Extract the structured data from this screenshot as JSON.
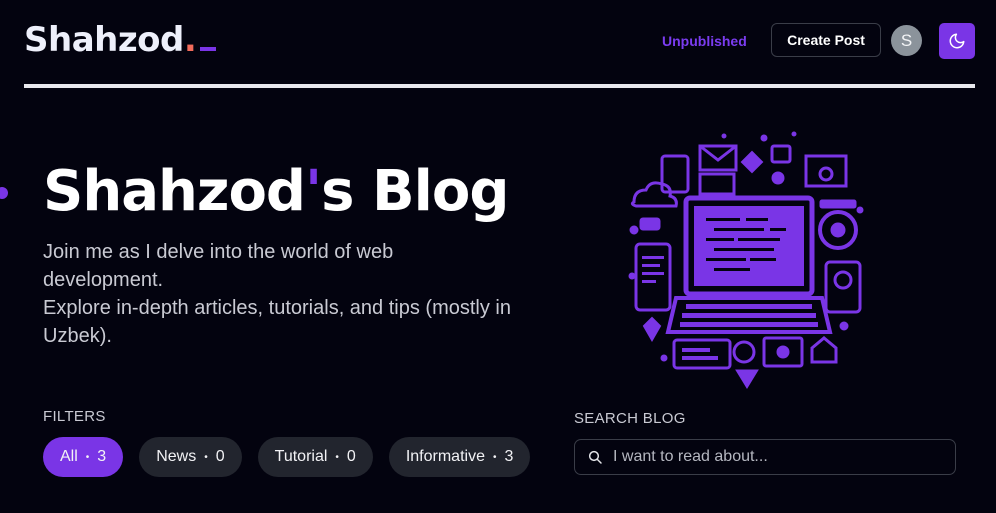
{
  "header": {
    "logo_text": "Shahzod",
    "logo_dot": ".",
    "nav_unpublished": "Unpublished",
    "create_post_label": "Create Post",
    "avatar_initial": "S",
    "theme_icon": "moon-icon"
  },
  "hero": {
    "title_part1": "Shahzod",
    "title_apostrophe": "'",
    "title_part2": "s Blog",
    "description_line1": "Join me as I delve into the world of web development.",
    "description_line2": "Explore in-depth articles, tutorials, and tips (mostly in Uzbek)."
  },
  "filters": {
    "label": "FILTERS",
    "separator": "•",
    "items": [
      {
        "label": "All",
        "count": "3",
        "active": true
      },
      {
        "label": "News",
        "count": "0",
        "active": false
      },
      {
        "label": "Tutorial",
        "count": "0",
        "active": false
      },
      {
        "label": "Informative",
        "count": "3",
        "active": false
      }
    ]
  },
  "search": {
    "label": "SEARCH BLOG",
    "placeholder": "I want to read about...",
    "icon": "search-icon"
  },
  "colors": {
    "accent": "#7a35e6",
    "background": "#03030f",
    "chip": "#22252e",
    "logo_dot": "#f26b5b"
  }
}
